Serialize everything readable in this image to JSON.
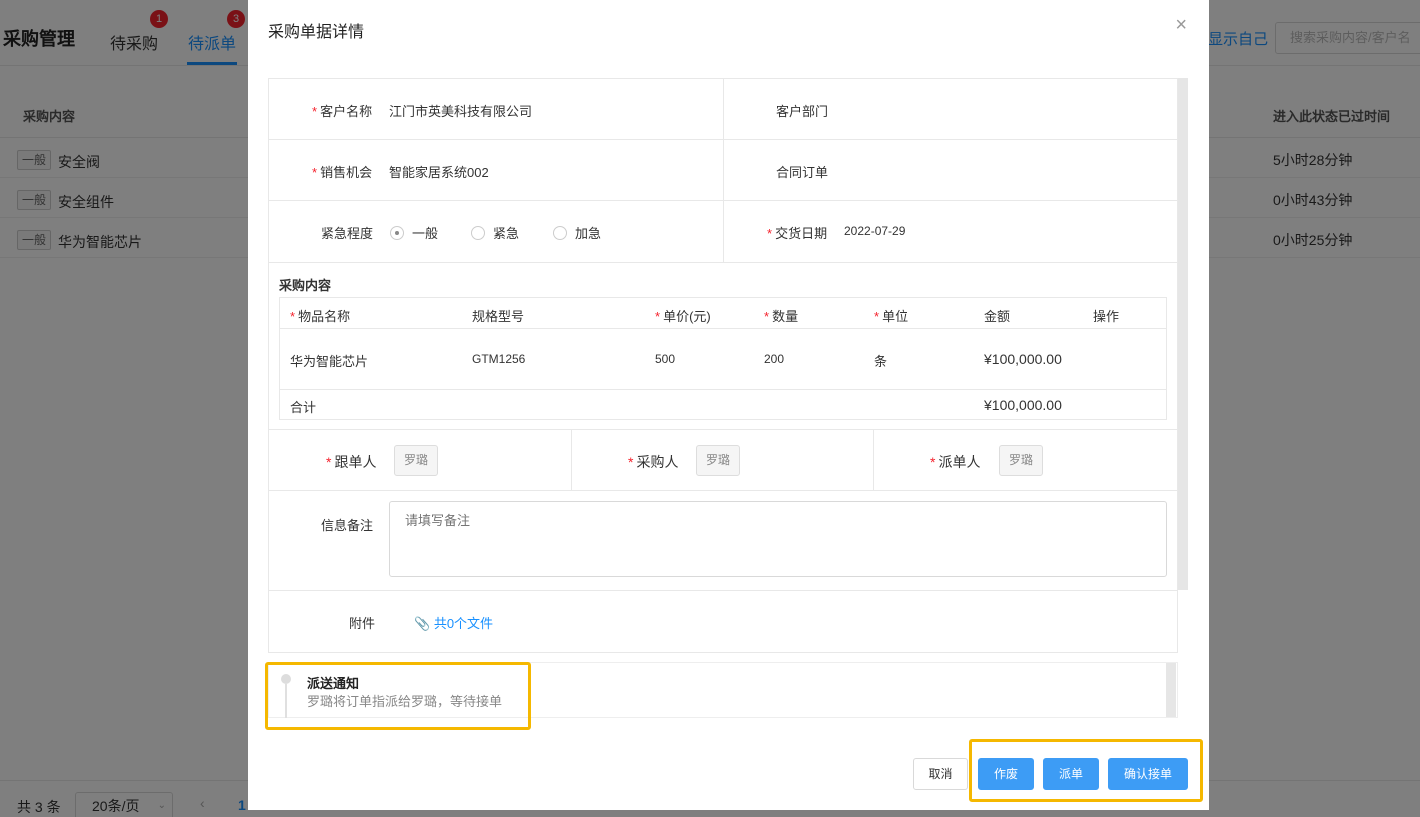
{
  "background": {
    "title": "采购管理",
    "tabs": [
      {
        "label": "待采购",
        "badge": "1"
      },
      {
        "label": "待派单",
        "badge": "3"
      }
    ],
    "show_self": "显示自己",
    "search_placeholder": "搜索采购内容/客户名",
    "columns": {
      "content": "采购内容",
      "elapsed": "进入此状态已过时间"
    },
    "rows": [
      {
        "tag": "一般",
        "name": "安全阀",
        "elapsed": "5小时28分钟"
      },
      {
        "tag": "一般",
        "name": "安全组件",
        "elapsed": "0小时43分钟"
      },
      {
        "tag": "一般",
        "name": "华为智能芯片",
        "elapsed": "0小时25分钟"
      }
    ],
    "footer": {
      "total": "共 3 条",
      "page_size": "20条/页",
      "current_page": "1"
    }
  },
  "modal": {
    "title": "采购单据详情",
    "close_icon": "close-icon",
    "customer": {
      "label": "客户名称",
      "value": "江门市英美科技有限公司"
    },
    "department": {
      "label": "客户部门",
      "value": ""
    },
    "opportunity": {
      "label": "销售机会",
      "value": "智能家居系统002"
    },
    "contract": {
      "label": "合同订单",
      "value": ""
    },
    "urgency": {
      "label": "紧急程度",
      "options": [
        "一般",
        "紧急",
        "加急"
      ],
      "selected": "一般"
    },
    "delivery": {
      "label": "交货日期",
      "value": "2022-07-29"
    },
    "purchase_section": "采购内容",
    "items_header": {
      "name": "物品名称",
      "spec": "规格型号",
      "price": "单价(元)",
      "qty": "数量",
      "unit": "单位",
      "amount": "金额",
      "action": "操作"
    },
    "items": [
      {
        "name": "华为智能芯片",
        "spec": "GTM1256",
        "price": "500",
        "qty": "200",
        "unit": "条",
        "amount": "¥100,000.00"
      }
    ],
    "total": {
      "label": "合计",
      "amount": "¥100,000.00"
    },
    "follower": {
      "label": "跟单人",
      "value": "罗璐"
    },
    "purchaser": {
      "label": "采购人",
      "value": "罗璐"
    },
    "dispatcher": {
      "label": "派单人",
      "value": "罗璐"
    },
    "remark": {
      "label": "信息备注",
      "placeholder": "请填写备注"
    },
    "attachment": {
      "label": "附件",
      "link": "共0个文件"
    },
    "notice": {
      "title": "派送通知",
      "text": "罗璐将订单指派给罗璐，等待接单"
    },
    "buttons": {
      "cancel": "取消",
      "void": "作废",
      "dispatch": "派单",
      "accept": "确认接单"
    },
    "highlight_color": "#f5b800",
    "primary_color": "#3d9cf5"
  }
}
